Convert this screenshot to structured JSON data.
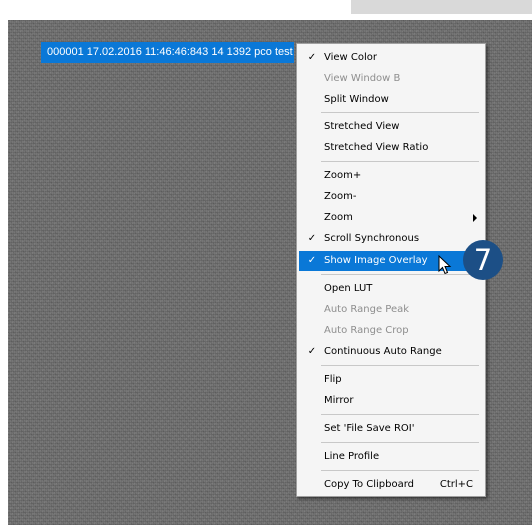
{
  "overlay": {
    "label": "000001 17.02.2016 11:46:46:843  14 1392 pco test"
  },
  "context_menu": {
    "items": [
      {
        "label": "View Color",
        "checked": true,
        "enabled": true
      },
      {
        "label": "View Window B",
        "checked": false,
        "enabled": false
      },
      {
        "label": "Split Window",
        "checked": false,
        "enabled": true
      },
      {
        "label": "Stretched View",
        "checked": false,
        "enabled": true
      },
      {
        "label": "Stretched View Ratio",
        "checked": false,
        "enabled": true
      },
      {
        "label": "Zoom+",
        "checked": false,
        "enabled": true
      },
      {
        "label": "Zoom-",
        "checked": false,
        "enabled": true
      },
      {
        "label": "Zoom",
        "checked": false,
        "enabled": true,
        "submenu": true
      },
      {
        "label": "Scroll Synchronous",
        "checked": true,
        "enabled": true
      },
      {
        "label": "Show Image Overlay",
        "checked": true,
        "enabled": true,
        "highlighted": true
      },
      {
        "label": "Open LUT",
        "checked": false,
        "enabled": true
      },
      {
        "label": "Auto Range Peak",
        "checked": false,
        "enabled": false
      },
      {
        "label": "Auto Range Crop",
        "checked": false,
        "enabled": false
      },
      {
        "label": "Continuous Auto Range",
        "checked": true,
        "enabled": true
      },
      {
        "label": "Flip",
        "checked": false,
        "enabled": true
      },
      {
        "label": "Mirror",
        "checked": false,
        "enabled": true
      },
      {
        "label": "Set 'File Save ROI'",
        "checked": false,
        "enabled": true
      },
      {
        "label": "Line Profile",
        "checked": false,
        "enabled": true
      },
      {
        "label": "Copy To Clipboard",
        "checked": false,
        "enabled": true,
        "shortcut": "Ctrl+C"
      }
    ],
    "check_glyph": "✓"
  },
  "step_badge": {
    "number": "7"
  },
  "colors": {
    "highlight": "#0a78d7",
    "badge": "#1c4f86",
    "disabled_text": "#8e8e8e"
  }
}
